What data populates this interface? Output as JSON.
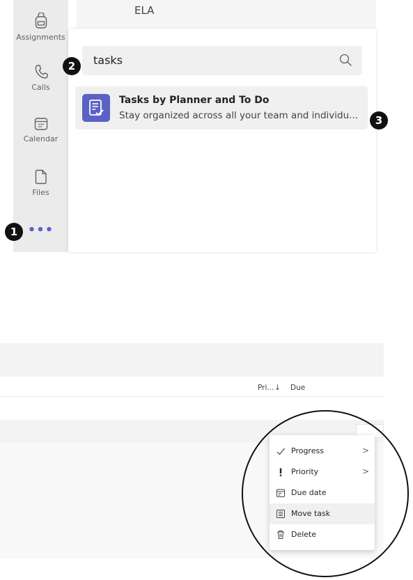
{
  "rail": {
    "items": [
      {
        "label": "Assignments",
        "icon": "backpack-icon"
      },
      {
        "label": "Calls",
        "icon": "phone-icon"
      },
      {
        "label": "Calendar",
        "icon": "calendar-icon"
      },
      {
        "label": "Files",
        "icon": "file-icon"
      }
    ],
    "more_label": "•••"
  },
  "top": {
    "team_label": "ELA"
  },
  "search": {
    "value": "tasks"
  },
  "result": {
    "title": "Tasks by Planner and To Do",
    "description": "Stay organized across all your team and individu..."
  },
  "badges": {
    "one": "1",
    "two": "2",
    "three": "3"
  },
  "list": {
    "col_priority": "Pri...",
    "col_sort": "↓",
    "col_due": "Due"
  },
  "menu": {
    "items": [
      {
        "label": "Progress",
        "icon": "check-icon",
        "has_submenu": true
      },
      {
        "label": "Priority",
        "icon": "exclamation-icon",
        "has_submenu": true
      },
      {
        "label": "Due date",
        "icon": "calendar-icon",
        "has_submenu": false
      },
      {
        "label": "Move task",
        "icon": "move-task-icon",
        "has_submenu": false
      },
      {
        "label": "Delete",
        "icon": "trash-icon",
        "has_submenu": false
      }
    ],
    "chevron": ">"
  },
  "colors": {
    "brand": "#5c61c4",
    "rail_bg": "#ebebeb"
  }
}
